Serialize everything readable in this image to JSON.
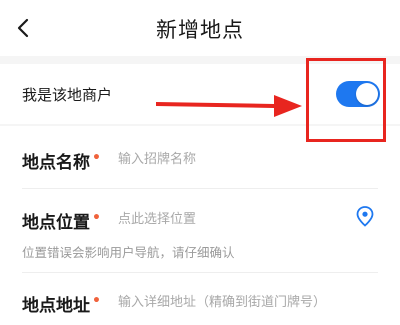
{
  "header": {
    "title": "新增地点",
    "back_icon": "chevron-left-icon"
  },
  "merchant": {
    "label": "我是该地商户",
    "toggle_on": true,
    "accent_color": "#1e78f0"
  },
  "annotation": {
    "color": "#e8251f"
  },
  "form": {
    "required_mark": "•",
    "name": {
      "label": "地点名称",
      "placeholder": "输入招牌名称"
    },
    "position": {
      "label": "地点位置",
      "placeholder": "点此选择位置",
      "icon": "location-pin-icon",
      "hint": "位置错误会影响用户导航，请仔细确认"
    },
    "address": {
      "label": "地点地址",
      "placeholder": "输入详细地址（精确到街道门牌号）"
    }
  }
}
